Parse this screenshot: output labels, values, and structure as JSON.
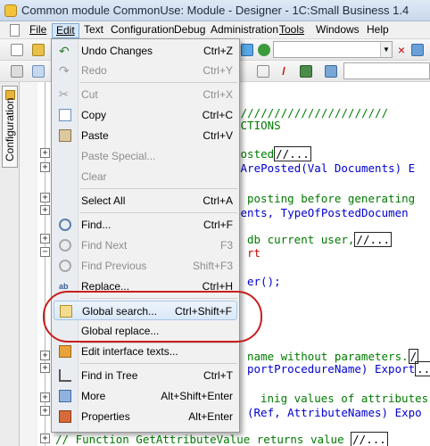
{
  "window": {
    "title": "Common module CommonUse: Module - Designer - 1C:Small Business 1.4"
  },
  "menubar": {
    "items": [
      {
        "label": "File"
      },
      {
        "label": "Edit"
      },
      {
        "label": "Text"
      },
      {
        "label": "Configuration"
      },
      {
        "label": "Debug"
      },
      {
        "label": "Administration"
      },
      {
        "label": "Tools"
      },
      {
        "label": "Windows"
      },
      {
        "label": "Help"
      }
    ]
  },
  "sidepanel": {
    "tab_label": "Configuration"
  },
  "edit_menu": {
    "items": [
      {
        "label": "Undo Changes",
        "shortcut": "Ctrl+Z",
        "icon": "undo-icon"
      },
      {
        "label": "Redo",
        "shortcut": "Ctrl+Y",
        "icon": "redo-icon"
      },
      {
        "label": "Cut",
        "shortcut": "Ctrl+X",
        "icon": "cut-icon"
      },
      {
        "label": "Copy",
        "shortcut": "Ctrl+C",
        "icon": "copy-icon"
      },
      {
        "label": "Paste",
        "shortcut": "Ctrl+V",
        "icon": "paste-icon"
      },
      {
        "label": "Paste Special...",
        "shortcut": "",
        "icon": ""
      },
      {
        "label": "Clear",
        "shortcut": "",
        "icon": ""
      },
      {
        "label": "Select All",
        "shortcut": "Ctrl+A",
        "icon": ""
      },
      {
        "label": "Find...",
        "shortcut": "Ctrl+F",
        "icon": "find-icon"
      },
      {
        "label": "Find Next",
        "shortcut": "F3",
        "icon": "find-next-icon"
      },
      {
        "label": "Find Previous",
        "shortcut": "Shift+F3",
        "icon": "find-previous-icon"
      },
      {
        "label": "Replace...",
        "shortcut": "Ctrl+H",
        "icon": "replace-icon"
      },
      {
        "label": "Global search...",
        "shortcut": "Ctrl+Shift+F",
        "icon": "global-search-icon"
      },
      {
        "label": "Global replace...",
        "shortcut": "",
        "icon": ""
      },
      {
        "label": "Edit interface texts...",
        "shortcut": "",
        "icon": "edit-texts-icon"
      },
      {
        "label": "Find in Tree",
        "shortcut": "Ctrl+T",
        "icon": "find-in-tree-icon"
      },
      {
        "label": "More",
        "shortcut": "Alt+Shift+Enter",
        "icon": "more-icon"
      },
      {
        "label": "Properties",
        "shortcut": "Alt+Enter",
        "icon": "properties-icon"
      }
    ]
  },
  "code": {
    "lines": [
      "///////////////////////////",
      "NCTIONS",
      "posted",
      "//...",
      "sArePosted(Val Documents) E",
      "posting before generating",
      "ments, TypeOfPostedDocumen",
      "db current user,",
      "//...",
      "rt",
      "er();",
      "name without parameters.",
      "/",
      "portProcedureName) Export",
      "...",
      "inig values of attributes",
      "(Ref, AttributeNames) Expo",
      "// Function GetAttributeValue returns value",
      "//..."
    ]
  },
  "colors": {
    "comment": "#007a00",
    "keyword": "#c80000",
    "identifier": "#0000d0",
    "highlight_ellipse": "#c81e1e",
    "menu_hover": "#d9e8f8"
  }
}
